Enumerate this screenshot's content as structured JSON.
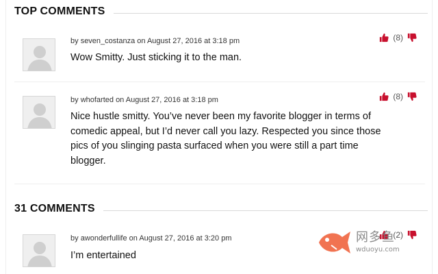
{
  "top_comments": {
    "title": "TOP COMMENTS",
    "items": [
      {
        "author": "seven_costanza",
        "meta_prefix": "by",
        "meta_on": "on",
        "date": "August 27, 2016 at 3:18 pm",
        "text": "Wow Smitty. Just sticking it to the man.",
        "votes": "(8)"
      },
      {
        "author": "whofarted",
        "meta_prefix": "by",
        "meta_on": "on",
        "date": "August 27, 2016 at 3:18 pm",
        "text": "Nice hustle smitty. You’ve never been my favorite blogger in terms of comedic appeal, but I’d never call you lazy. Respected you since those pics of you slinging pasta surfaced when you were still a part time blogger.",
        "votes": "(8)"
      }
    ]
  },
  "all_comments": {
    "title": "31 COMMENTS",
    "items": [
      {
        "author": "awonderfullife",
        "meta_prefix": "by",
        "meta_on": "on",
        "date": "August 27, 2016 at 3:20 pm",
        "text": "I’m entertained",
        "votes": "(2)"
      }
    ]
  },
  "watermark": {
    "main": "网多鱼",
    "sub": "wduoyu.com"
  },
  "colors": {
    "vote_red": "#c8102e",
    "watermark_fish": "#f0603a"
  },
  "icons": {
    "upvote": "thumbs-up-icon",
    "downvote": "thumbs-down-icon",
    "avatar": "default-avatar-icon"
  }
}
